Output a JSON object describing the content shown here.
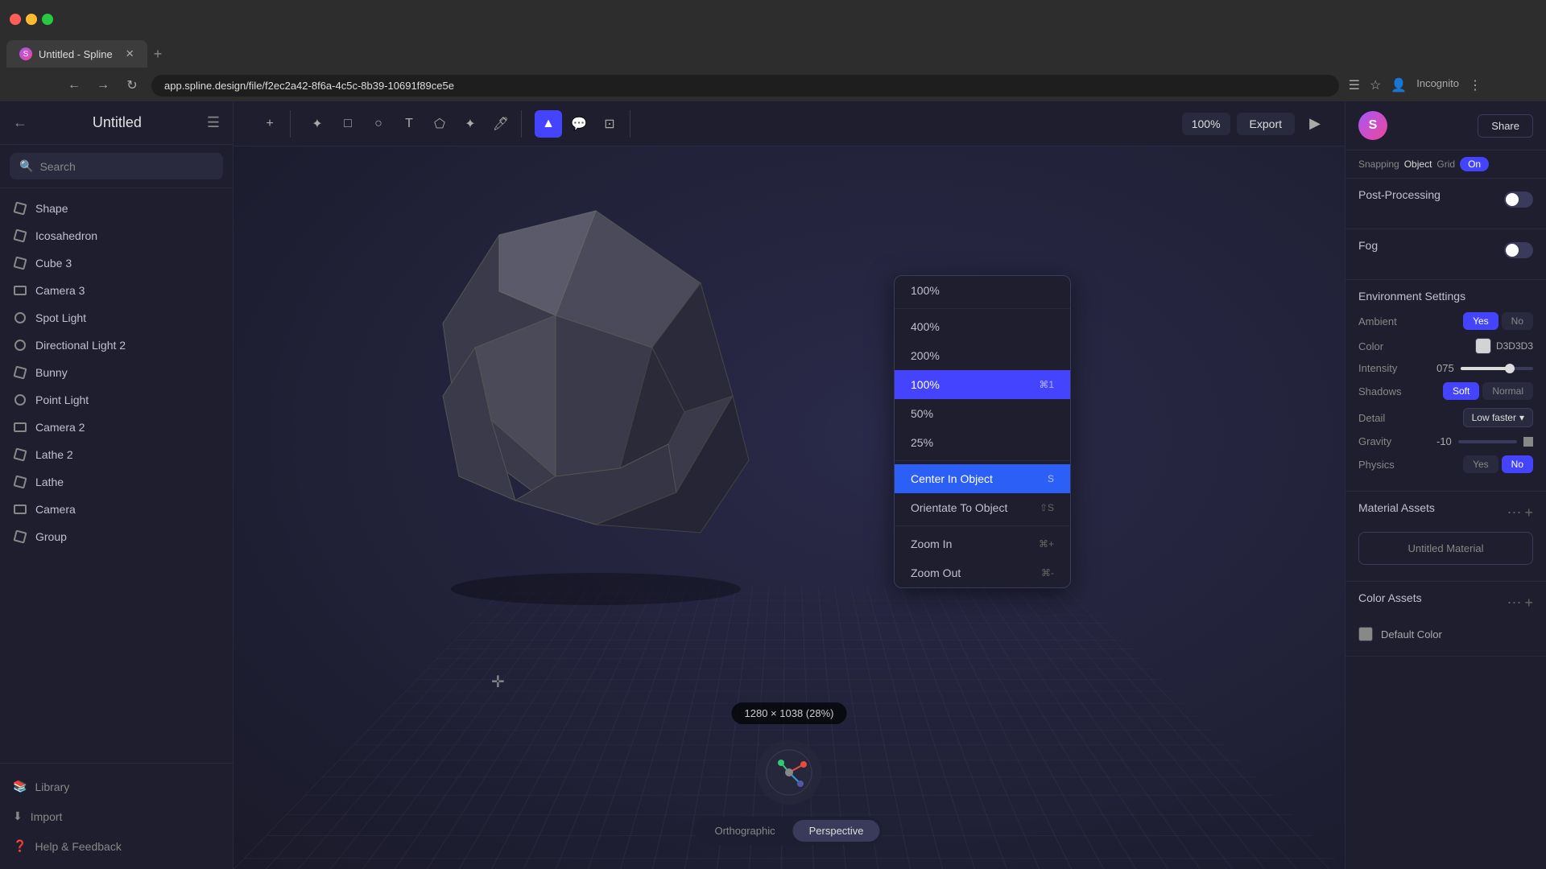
{
  "browser": {
    "tab_title": "Untitled - Spline",
    "address": "app.spline.design/file/f2ec2a42-8f6a-4c5c-8b39-10691f89ce5e",
    "incognito": "Incognito"
  },
  "sidebar": {
    "title": "Untitled",
    "search_placeholder": "Search",
    "items": [
      {
        "label": "Shape",
        "type": "cube"
      },
      {
        "label": "Icosahedron",
        "type": "cube"
      },
      {
        "label": "Cube 3",
        "type": "cube"
      },
      {
        "label": "Camera 3",
        "type": "camera"
      },
      {
        "label": "Spot Light",
        "type": "light"
      },
      {
        "label": "Directional Light 2",
        "type": "light"
      },
      {
        "label": "Bunny",
        "type": "cube"
      },
      {
        "label": "Point Light",
        "type": "light"
      },
      {
        "label": "Camera 2",
        "type": "camera"
      },
      {
        "label": "Lathe 2",
        "type": "cube"
      },
      {
        "label": "Lathe",
        "type": "cube"
      },
      {
        "label": "Camera",
        "type": "camera"
      },
      {
        "label": "Group",
        "type": "cube"
      }
    ],
    "library_label": "Library",
    "import_label": "Import",
    "help_label": "Help & Feedback"
  },
  "toolbar": {
    "zoom_level": "100%",
    "export_label": "Export"
  },
  "zoom_dropdown": {
    "items": [
      {
        "label": "100%",
        "shortcut": ""
      },
      {
        "label": "400%",
        "shortcut": ""
      },
      {
        "label": "200%",
        "shortcut": ""
      },
      {
        "label": "100%",
        "shortcut": "⌘1",
        "active": true
      },
      {
        "label": "50%",
        "shortcut": ""
      },
      {
        "label": "25%",
        "shortcut": ""
      }
    ],
    "center_label": "Center In Object",
    "center_shortcut": "S",
    "orientate_label": "Orientate To Object",
    "orientate_shortcut": "⇧S",
    "zoom_in_label": "Zoom In",
    "zoom_in_shortcut": "⌘+",
    "zoom_out_label": "Zoom Out",
    "zoom_out_shortcut": "⌘-"
  },
  "canvas": {
    "dimension_label": "1280 × 1038 (28%)",
    "view_orthographic": "Orthographic",
    "view_perspective": "Perspective"
  },
  "right_panel": {
    "user_initial": "S",
    "share_label": "Share",
    "snapping": {
      "label": "Snapping",
      "object_label": "Object",
      "grid_label": "Grid",
      "on_label": "On"
    },
    "post_processing": {
      "title": "Post-Processing"
    },
    "fog": {
      "title": "Fog"
    },
    "environment": {
      "title": "Environment Settings",
      "ambient_label": "Ambient",
      "yes_label": "Yes",
      "no_label": "No",
      "color_label": "Color",
      "color_value": "D3D3D3",
      "intensity_label": "Intensity",
      "intensity_value": "075",
      "shadows_label": "Shadows",
      "soft_label": "Soft",
      "normal_label": "Normal",
      "detail_label": "Detail",
      "detail_value": "Low faster",
      "gravity_label": "Gravity",
      "gravity_value": "-10",
      "physics_label": "Physics",
      "physics_yes": "Yes",
      "physics_no": "No"
    },
    "material_assets": {
      "title": "Material Assets",
      "item_label": "Untitled Material"
    },
    "color_assets": {
      "title": "Color Assets",
      "item_label": "Default Color"
    }
  }
}
